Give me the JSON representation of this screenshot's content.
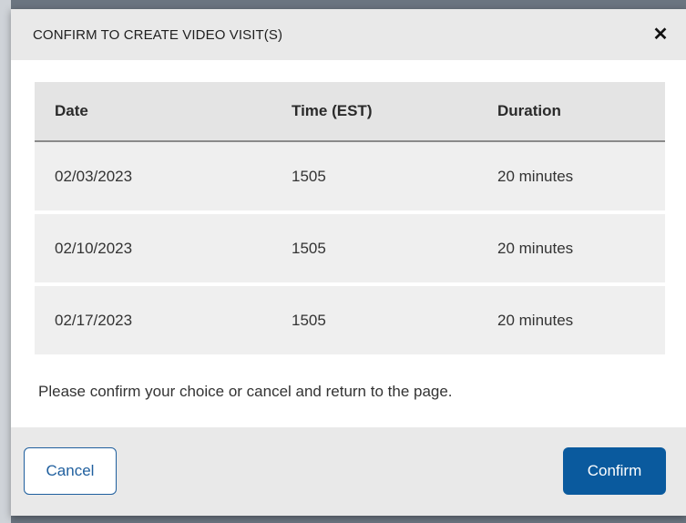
{
  "dialog": {
    "title": "CONFIRM TO CREATE VIDEO VISIT(S)",
    "close_icon": "close-icon",
    "close_glyph": "✕"
  },
  "table": {
    "headers": [
      "Date",
      "Time (EST)",
      "Duration"
    ],
    "rows": [
      [
        "02/03/2023",
        "1505",
        "20 minutes"
      ],
      [
        "02/10/2023",
        "1505",
        "20 minutes"
      ],
      [
        "02/17/2023",
        "1505",
        "20 minutes"
      ]
    ]
  },
  "message": "Please confirm your choice or cancel and return to the page.",
  "footer": {
    "cancel_label": "Cancel",
    "confirm_label": "Confirm"
  },
  "colors": {
    "primary": "#0a5a9e",
    "header_bg": "#e9e9e9",
    "row_bg": "#efefef"
  }
}
